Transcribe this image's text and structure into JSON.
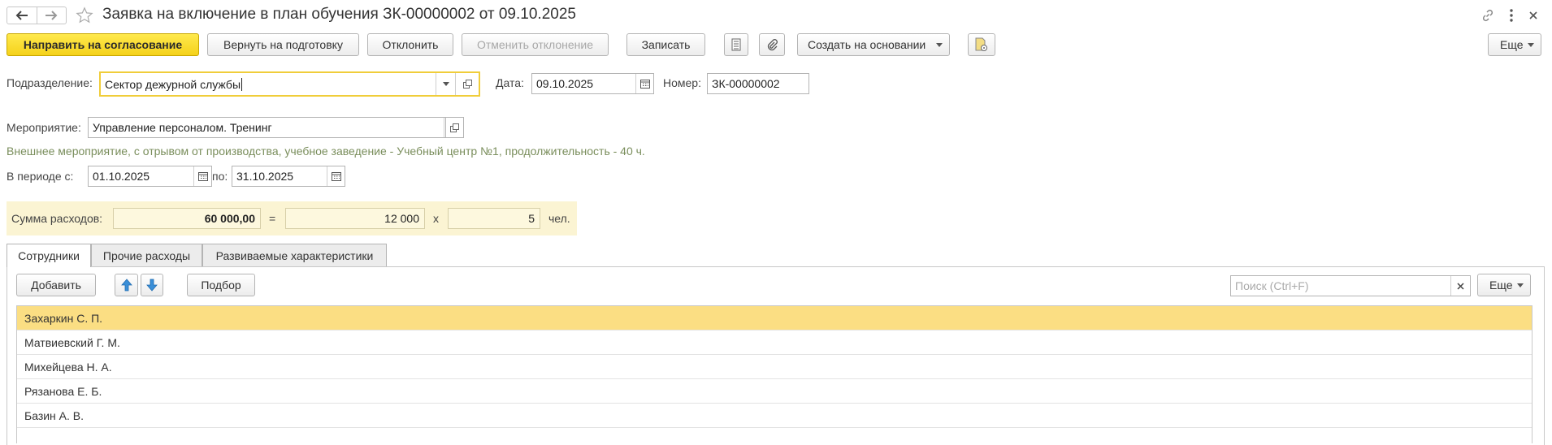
{
  "window": {
    "title": "Заявка на включение в план обучения ЗК-00000002 от 09.10.2025",
    "back_icon": "arrow-left-icon",
    "forward_icon": "arrow-right-icon",
    "favorite_icon": "star-icon"
  },
  "toolbar": {
    "send_label": "Направить на согласование",
    "return_label": "Вернуть на подготовку",
    "reject_label": "Отклонить",
    "cancel_reject_label": "Отменить отклонение",
    "save_label": "Записать",
    "create_based_label": "Создать на основании",
    "more_label": "Еще",
    "accent_color": "#f5d21b"
  },
  "form": {
    "division_label": "Подразделение:",
    "division_value": "Сектор дежурной службы",
    "date_label": "Дата:",
    "date_value": "09.10.2025",
    "number_label": "Номер:",
    "number_value": "ЗК-00000002",
    "event_label": "Мероприятие:",
    "event_value": "Управление персоналом. Тренинг",
    "event_description": "Внешнее мероприятие, с отрывом от производства, учебное заведение - Учебный центр №1, продолжительность - 40 ч.",
    "period_from_label": "В периоде с:",
    "period_from_value": "01.10.2025",
    "period_to_label": "по:",
    "period_to_value": "31.10.2025",
    "cost_label": "Сумма расходов:",
    "cost_total": "60 000,00",
    "equals_sign": "=",
    "cost_per_person": "12 000",
    "multiply_sign": "x",
    "people_count": "5",
    "people_unit": "чел."
  },
  "tabs": [
    {
      "label": "Сотрудники",
      "active": true
    },
    {
      "label": "Прочие расходы",
      "active": false
    },
    {
      "label": "Развиваемые характеристики",
      "active": false
    }
  ],
  "table_toolbar": {
    "add_label": "Добавить",
    "pick_label": "Подбор",
    "search_placeholder": "Поиск (Ctrl+F)",
    "more_label": "Еще"
  },
  "employees": [
    {
      "name": "Захаркин С. П.",
      "selected": true
    },
    {
      "name": "Матвиевский Г. М.",
      "selected": false
    },
    {
      "name": "Михейцева Н. А.",
      "selected": false
    },
    {
      "name": "Рязанова Е. Б.",
      "selected": false
    },
    {
      "name": "Базин А. В.",
      "selected": false
    }
  ]
}
